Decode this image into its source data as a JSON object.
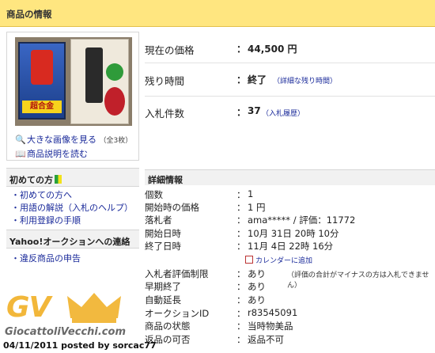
{
  "header": {
    "title": "商品の情報"
  },
  "image_panel": {
    "box_text": "超合金",
    "link_large": "大きな画像を見る",
    "link_large_count": "（全3枚）",
    "link_desc": "商品説明を読む"
  },
  "sidebar": {
    "section1_title": "初めての方",
    "links1": [
      "・初めての方へ",
      "・用語の解説（入札のヘルプ）",
      "・利用登録の手順"
    ],
    "section2_title": "Yahoo!オークションへの連絡",
    "links2": [
      "・違反商品の申告"
    ]
  },
  "summary": [
    {
      "label": "現在の価格",
      "value": "44,500 円",
      "sub": ""
    },
    {
      "label": "残り時間",
      "value": "終了",
      "sub": "（詳細な残り時間）"
    },
    {
      "label": "入札件数",
      "value": "37",
      "sub": "（入札履歴）"
    }
  ],
  "details_title": "詳細情報",
  "details": [
    {
      "label": "個数",
      "value": "1"
    },
    {
      "label": "開始時の価格",
      "value": "1 円"
    },
    {
      "label": "落札者",
      "value": "ama***** / 評価：11772"
    },
    {
      "label": "開始日時",
      "value": "10月 31日 20時 10分"
    },
    {
      "label": "終了日時",
      "value": "11月 4日 22時 16分"
    },
    {
      "label": "入札者評価制限",
      "value": "あり",
      "note": "（評価の合計がマイナスの方は入札できません）"
    },
    {
      "label": "早期終了",
      "value": "あり"
    },
    {
      "label": "自動延長",
      "value": "あり"
    },
    {
      "label": "オークションID",
      "value": "r83545091"
    },
    {
      "label": "商品の状態",
      "value": "当時物美品"
    },
    {
      "label": "返品の可否",
      "value": "返品不可"
    }
  ],
  "calendar_link": "カレンダーに追加",
  "colon": "：",
  "watermark": {
    "logo": "GV",
    "site": "GiocattoliVecchi.com",
    "posted": "04/11/2011 posted by sorcac77"
  },
  "colors": {
    "header_bg": "#ffe680",
    "link": "#1a2a9a",
    "watermark": "#f1b12a"
  }
}
